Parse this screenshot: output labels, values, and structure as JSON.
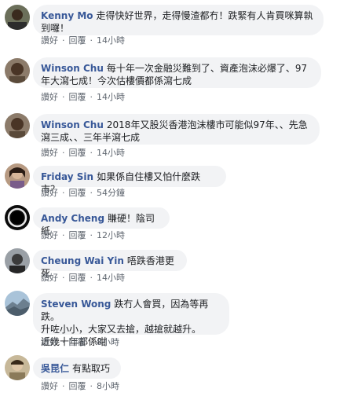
{
  "actions": {
    "like": "讚好",
    "reply": "回覆",
    "separator": "·"
  },
  "comments": [
    {
      "author": "Kenny Mo",
      "text": "走得快好世界，走得慢渣都冇！跌緊有人肯買咪算執到囉！",
      "time": "14小時"
    },
    {
      "author": "Winson Chu",
      "text": "每十年一次金融災難到了、資產泡沫必爆了、97年大瀉七成！今次估樓價都係瀉七成",
      "time": "14小時"
    },
    {
      "author": "Winson Chu",
      "text": "2018年又股災香港泡沫樓市可能似97年、、先急瀉三成、、三年半瀉七成",
      "time": "14小時"
    },
    {
      "author": "Friday Sin",
      "text": "如果係自住樓又怕什麼跌市？",
      "time": "54分鐘"
    },
    {
      "author": "Andy Cheng",
      "text": "賺硬！陰司紙",
      "time": "12小時"
    },
    {
      "author": "Cheung Wai Yin",
      "text": "唔跌香港更死",
      "time": "14小時"
    },
    {
      "author": "Steven Wong",
      "text": "跌冇人會買，因為等再跌。\n升咗小小，大家又去搶，越搶就越升。\n近幾十年都係咁",
      "time": "8小時"
    },
    {
      "author": "吳昆仁",
      "text": "有點取巧",
      "time": "8小時"
    }
  ]
}
